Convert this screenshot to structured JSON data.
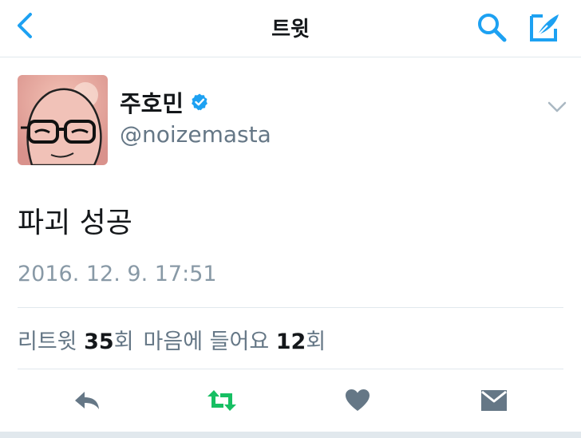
{
  "nav": {
    "title": "트윗",
    "back_icon": "chevron-left-icon",
    "search_icon": "search-icon",
    "compose_icon": "compose-tweet-icon"
  },
  "tweet": {
    "author_name": "주호민",
    "verified": true,
    "handle": "@noizemasta",
    "text": "파괴 성공",
    "timestamp": "2016. 12. 9. 17:51",
    "stats": {
      "retweet_label": "리트윗",
      "retweet_count": "35",
      "retweet_unit": "회",
      "like_label": "마음에 들어요",
      "like_count": "12",
      "like_unit": "회"
    }
  },
  "actions": {
    "reply_icon": "reply-icon",
    "retweet_icon": "retweet-icon",
    "like_icon": "heart-icon",
    "dm_icon": "direct-message-icon"
  },
  "colors": {
    "accent": "#1da1f2",
    "retweet_green": "#17bf63",
    "muted": "#8899a6",
    "action_gray": "#657786"
  }
}
